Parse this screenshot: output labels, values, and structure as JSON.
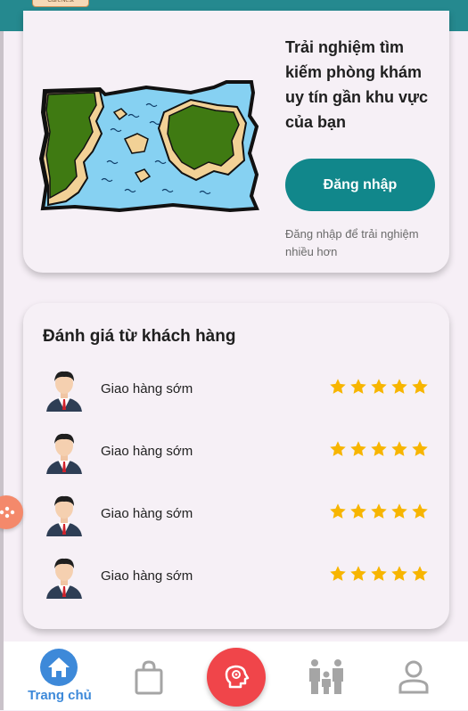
{
  "header": {
    "logo_text": "CareNest"
  },
  "hero": {
    "title": "Trải nghiệm tìm kiếm phòng khám uy tín gần khu vực của bạn",
    "login_button": "Đăng nhập",
    "hint": "Đăng nhập để trải nghiệm nhiều hơn"
  },
  "reviews": {
    "title": "Đánh giá từ khách hàng",
    "items": [
      {
        "text": "Giao hàng sớm",
        "rating": 5
      },
      {
        "text": "Giao hàng sớm",
        "rating": 5
      },
      {
        "text": "Giao hàng sớm",
        "rating": 5
      },
      {
        "text": "Giao hàng sớm",
        "rating": 5
      }
    ]
  },
  "bottom_nav": {
    "items": [
      {
        "label": "Trang chủ",
        "icon": "home-icon",
        "active": true
      },
      {
        "label": "",
        "icon": "shopping-bag-icon",
        "active": false
      },
      {
        "label": "",
        "icon": "brain-icon",
        "active": false
      },
      {
        "label": "",
        "icon": "family-icon",
        "active": false
      },
      {
        "label": "",
        "icon": "profile-icon",
        "active": false
      }
    ]
  },
  "colors": {
    "primary": "#11878b",
    "header": "#25898f",
    "nav_active": "#3d89d9",
    "center_button": "#f0454a",
    "star": "#f7b500"
  }
}
